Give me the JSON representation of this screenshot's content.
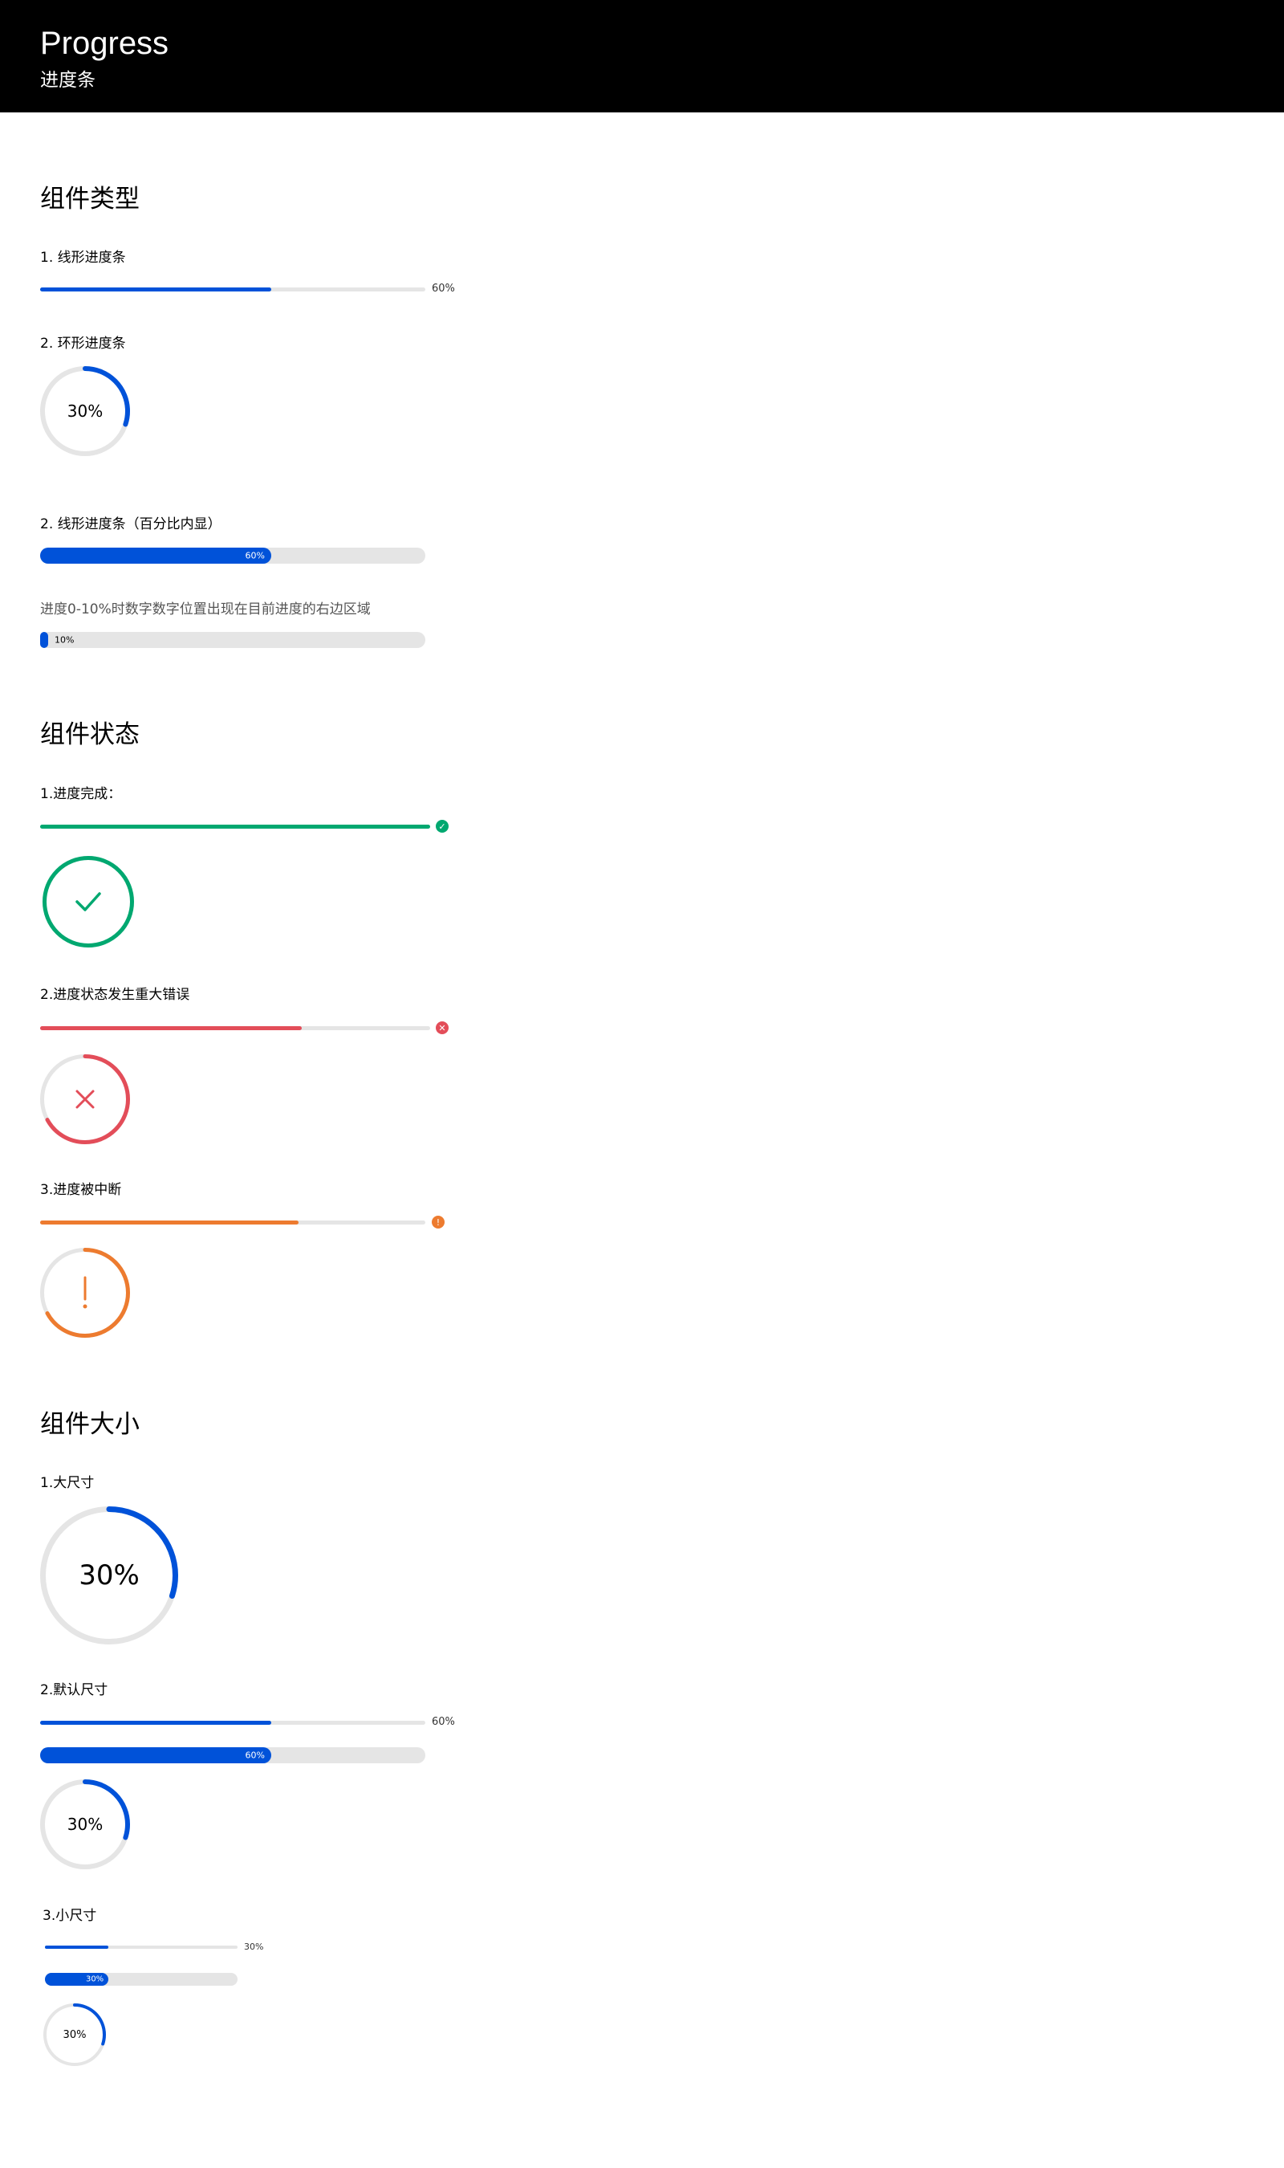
{
  "header": {
    "title": "Progress",
    "subtitle": "进度条"
  },
  "colors": {
    "primary": "#0052d9",
    "success": "#00a870",
    "error": "#e34d59",
    "warning": "#ed7b2f",
    "track": "#e5e5e5"
  },
  "sections": {
    "types": {
      "title": "组件类型",
      "linear_label": "1. 线形进度条",
      "linear_percent": "60%",
      "linear_value": 0.6,
      "circle_label": "2. 环形进度条",
      "circle_percent": "30%",
      "circle_value": 0.3,
      "inner_label": "2. 线形进度条（百分比内显）",
      "inner_percent": "60%",
      "inner_value": 0.6,
      "inner_note": "进度0-10%时数字数字位置出现在目前进度的右边区域",
      "inner_low_percent": "10%",
      "inner_low_value": 0.02
    },
    "states": {
      "title": "组件状态",
      "success_label": "1.进度完成：",
      "success_value": 1.0,
      "error_label": "2.进度状态发生重大错误",
      "error_value": 0.67,
      "warning_label": "3.进度被中断",
      "warning_value": 0.67,
      "success_icon": "check-icon",
      "error_icon": "close-icon",
      "warning_icon": "exclamation-icon"
    },
    "sizes": {
      "title": "组件大小",
      "large_label": "1.大尺寸",
      "large_percent": "30%",
      "large_value": 0.3,
      "default_label": "2.默认尺寸",
      "default_linear_percent": "60%",
      "default_linear_value": 0.6,
      "default_inner_percent": "60%",
      "default_inner_value": 0.6,
      "default_circle_percent": "30%",
      "default_circle_value": 0.3,
      "small_label": "3.小尺寸",
      "small_linear_percent": "30%",
      "small_linear_value": 0.33,
      "small_inner_percent": "30%",
      "small_inner_value": 0.33,
      "small_circle_percent": "30%",
      "small_circle_value": 0.3
    }
  }
}
